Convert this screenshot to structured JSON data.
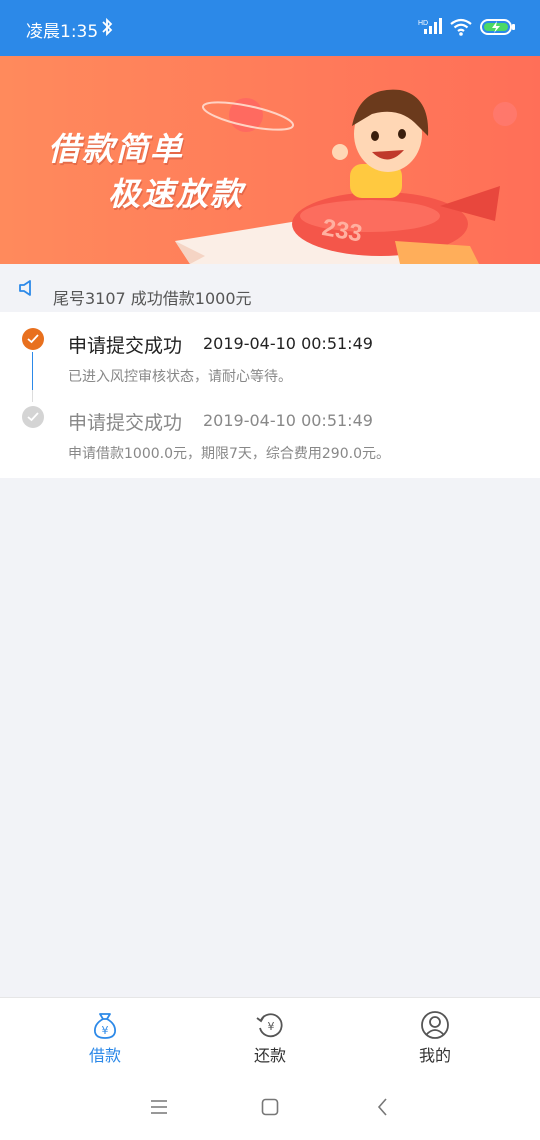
{
  "status_bar": {
    "time": "凌晨1:35",
    "signal_badge": "HD",
    "bg_color": "#2c89e8"
  },
  "banner": {
    "line1": "借款简单",
    "line2": "极速放款",
    "plane_number": "233"
  },
  "notice": {
    "text": "尾号3107 成功借款1000元"
  },
  "timeline": {
    "steps": [
      {
        "title": "申请提交成功",
        "time": "2019-04-10 00:51:49",
        "desc": "已进入风控审核状态，请耐心等待。",
        "state": "active",
        "color": "#e8701e"
      },
      {
        "title": "申请提交成功",
        "time": "2019-04-10 00:51:49",
        "desc": "申请借款1000.0元，期限7天，综合费用290.0元。",
        "state": "done",
        "color": "#d4d4d4"
      }
    ]
  },
  "bottom_nav": {
    "items": [
      {
        "label": "借款",
        "icon": "money-bag-icon",
        "active": true
      },
      {
        "label": "还款",
        "icon": "repay-cycle-icon",
        "active": false
      },
      {
        "label": "我的",
        "icon": "user-icon",
        "active": false
      }
    ],
    "accent": "#2c89e8"
  },
  "system_nav": {
    "buttons": [
      "menu-icon",
      "home-icon",
      "back-icon"
    ]
  }
}
